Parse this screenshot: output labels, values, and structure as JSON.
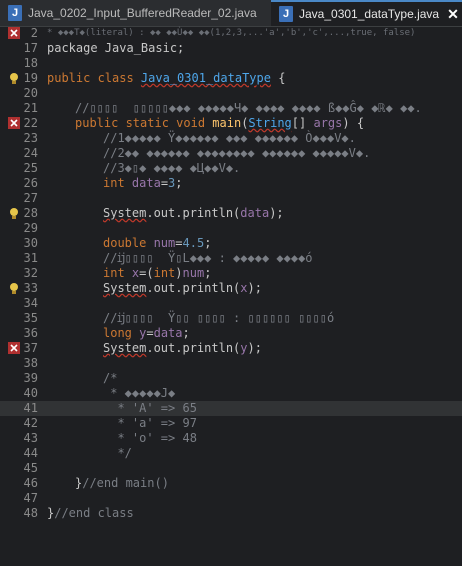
{
  "tabs": [
    {
      "label": "Java_0202_Input_BufferedReader_02.java",
      "active": false
    },
    {
      "label": "Java_0301_dataType.java",
      "active": true
    }
  ],
  "close_glyph": "✕",
  "lines": {
    "l2": "* ◆◆◆T◆(literal) : ◆◆ ◆◆Ù◆◆ ◆◆(1,2,3,...'a','b','c',...,true, false)",
    "l17": "package Java_Basic;",
    "l19a": "public class ",
    "l19b": "Java_0301_dataType",
    "l19c": " {",
    "l21": "//▯▯▯▯  ▯▯▯▯▯◆◆◆ ◆◆◆◆◆Ч◆ ◆◆◆◆ ◆◆◆◆ ß◆◆Ĝ◆ ◆ℝ◆ ◆◆.",
    "l22a": "public static void ",
    "l22b": "main",
    "l22c": "(",
    "l22d": "String",
    "l22e": "[] ",
    "l22f": "args",
    "l22g": ") {",
    "l23": "//1◆◆◆◆◆ Ÿ◆◆◆◆◆◆ ◆◆◆ ◆◆◆◆◆◆ Ò◆◆◆V◆.",
    "l24": "//2◆◆ ◆◆◆◆◆◆ ◆◆◆◆◆◆◆◆ ◆◆◆◆◆◆ ◆◆◆◆◆V◆.",
    "l25": "//3◆▯◆ ◆◆◆◆ ◆Ц◆◆V◆.",
    "l26a": "int ",
    "l26b": "data",
    "l26c": "=",
    "l26d": "3",
    "l26e": ";",
    "l28a": "System",
    "l28b": ".out.println(",
    "l28c": "data",
    "l28d": ");",
    "l30a": "double ",
    "l30b": "num",
    "l30c": "=",
    "l30d": "4.5",
    "l30e": ";",
    "l31": "//ĳ▯▯▯▯  Ÿ▯L◆◆◆ : ◆◆◆◆◆ ◆◆◆◆ó",
    "l32a": "int ",
    "l32b": "x",
    "l32c": "=(",
    "l32d": "int",
    "l32e": ")",
    "l32f": "num",
    "l32g": ";",
    "l33a": "System",
    "l33b": ".out.println(",
    "l33c": "x",
    "l33d": ");",
    "l35": "//ĳ▯▯▯▯  Ÿ▯▯ ▯▯▯▯ : ▯▯▯▯▯▯ ▯▯▯▯ó",
    "l36a": "long ",
    "l36b": "y",
    "l36c": "=",
    "l36d": "data",
    "l36e": ";",
    "l37a": "System",
    "l37b": ".out.println(",
    "l37c": "y",
    "l37d": ");",
    "l39": "/*",
    "l40": " * ◆◆◆◆◆J◆",
    "l41": "  * 'A' => 65",
    "l42": "  * 'a' => 97",
    "l43": "  * 'o' => 48",
    "l44": "  */",
    "l46a": "}",
    "l46b": "//end main()",
    "l48a": "}",
    "l48b": "//end class"
  },
  "line_numbers": [
    "2",
    "17",
    "18",
    "19",
    "20",
    "21",
    "22",
    "23",
    "24",
    "25",
    "26",
    "27",
    "28",
    "29",
    "30",
    "31",
    "32",
    "33",
    "34",
    "35",
    "36",
    "37",
    "38",
    "39",
    "40",
    "41",
    "42",
    "43",
    "44",
    "45",
    "46",
    "47",
    "48"
  ]
}
